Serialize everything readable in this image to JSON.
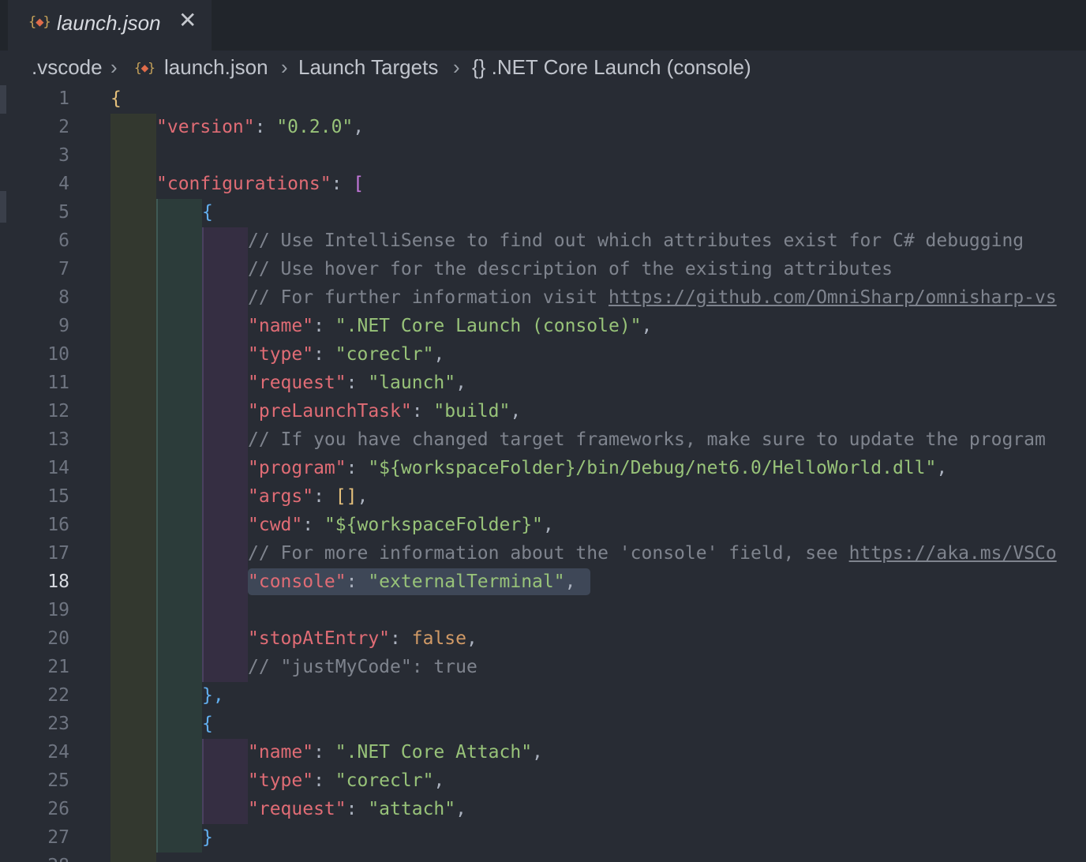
{
  "tab": {
    "icon": "json-braces-icon",
    "title": "launch.json",
    "close_glyph": "✕"
  },
  "breadcrumb": {
    "items": [
      ".vscode",
      "launch.json",
      "Launch Targets",
      "{} .NET Core Launch (console)"
    ],
    "separator": "›"
  },
  "editor": {
    "active_line": 18,
    "colors": {
      "key": "#e06c75",
      "string": "#98c379",
      "comment": "#7f848e",
      "number": "#d19a66",
      "background": "#282c34"
    },
    "lines": [
      {
        "n": "1",
        "text": "{"
      },
      {
        "n": "2",
        "key": "\"version\"",
        "value": "\"0.2.0\""
      },
      {
        "n": "3"
      },
      {
        "n": "4",
        "key": "\"configurations\"",
        "value": "["
      },
      {
        "n": "5",
        "text": "{"
      },
      {
        "n": "6",
        "comment": "// Use IntelliSense to find out which attributes exist for C# debugging"
      },
      {
        "n": "7",
        "comment": "// Use hover for the description of the existing attributes"
      },
      {
        "n": "8",
        "comment": "// For further information visit ",
        "link": "https://github.com/OmniSharp/omnisharp-vs"
      },
      {
        "n": "9",
        "key": "\"name\"",
        "value": "\".NET Core Launch (console)\""
      },
      {
        "n": "10",
        "key": "\"type\"",
        "value": "\"coreclr\""
      },
      {
        "n": "11",
        "key": "\"request\"",
        "value": "\"launch\""
      },
      {
        "n": "12",
        "key": "\"preLaunchTask\"",
        "value": "\"build\""
      },
      {
        "n": "13",
        "comment": "// If you have changed target frameworks, make sure to update the program"
      },
      {
        "n": "14",
        "key": "\"program\"",
        "value": "\"${workspaceFolder}/bin/Debug/net6.0/HelloWorld.dll\""
      },
      {
        "n": "15",
        "key": "\"args\"",
        "value": "[]"
      },
      {
        "n": "16",
        "key": "\"cwd\"",
        "value": "\"${workspaceFolder}\""
      },
      {
        "n": "17",
        "comment": "// For more information about the 'console' field, see ",
        "link": "https://aka.ms/VSCo"
      },
      {
        "n": "18",
        "key": "\"console\"",
        "value": "\"externalTerminal\""
      },
      {
        "n": "19"
      },
      {
        "n": "20",
        "key": "\"stopAtEntry\"",
        "value": "false"
      },
      {
        "n": "21",
        "comment": "// \"justMyCode\": true"
      },
      {
        "n": "22",
        "text": "},"
      },
      {
        "n": "23",
        "text": "{"
      },
      {
        "n": "24",
        "key": "\"name\"",
        "value": "\".NET Core Attach\""
      },
      {
        "n": "25",
        "key": "\"type\"",
        "value": "\"coreclr\""
      },
      {
        "n": "26",
        "key": "\"request\"",
        "value": "\"attach\""
      },
      {
        "n": "27",
        "text": "}"
      },
      {
        "n": "28"
      }
    ]
  }
}
